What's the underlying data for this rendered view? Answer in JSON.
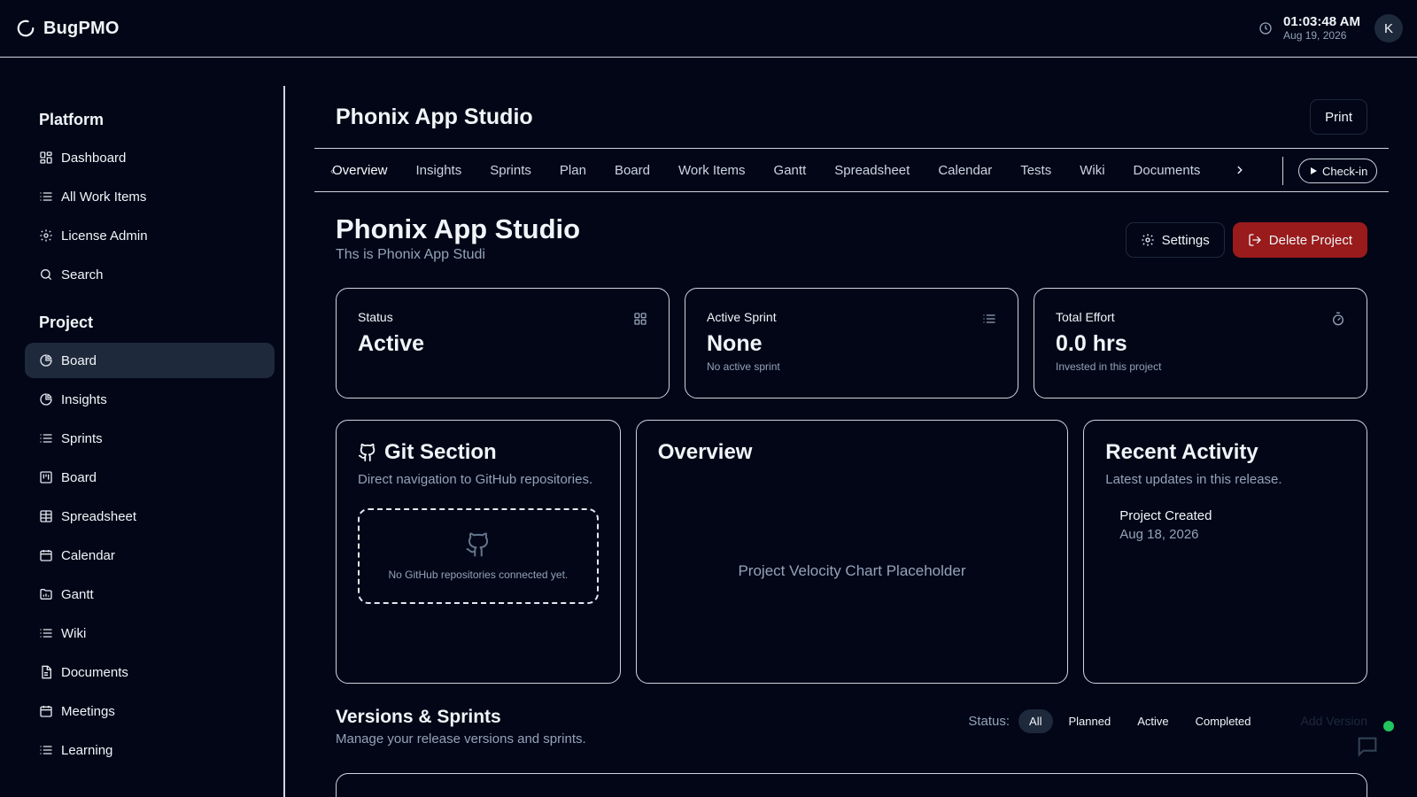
{
  "header": {
    "brand": "BugPMO",
    "time": "01:03:48 AM",
    "date": "Aug 19, 2026",
    "avatar_initial": "K"
  },
  "sidebar": {
    "platform_title": "Platform",
    "platform_items": [
      {
        "label": "Dashboard",
        "icon": "dashboard-grid-icon"
      },
      {
        "label": "All Work Items",
        "icon": "list-icon"
      },
      {
        "label": "License Admin",
        "icon": "gear-icon"
      },
      {
        "label": "Search",
        "icon": "search-icon"
      }
    ],
    "project_title": "Project",
    "project_items": [
      {
        "label": "Board",
        "icon": "pie-chart-icon",
        "active": true
      },
      {
        "label": "Insights",
        "icon": "pie-chart-icon"
      },
      {
        "label": "Sprints",
        "icon": "list-icon"
      },
      {
        "label": "Board",
        "icon": "kanban-icon"
      },
      {
        "label": "Spreadsheet",
        "icon": "table-icon"
      },
      {
        "label": "Calendar",
        "icon": "calendar-icon"
      },
      {
        "label": "Gantt",
        "icon": "folder-chart-icon"
      },
      {
        "label": "Wiki",
        "icon": "list-icon"
      },
      {
        "label": "Documents",
        "icon": "document-icon"
      },
      {
        "label": "Meetings",
        "icon": "calendar-icon"
      },
      {
        "label": "Learning",
        "icon": "list-icon"
      }
    ]
  },
  "page": {
    "title": "Phonix App Studio",
    "print_label": "Print"
  },
  "tabs": {
    "items": [
      "Overview",
      "Insights",
      "Sprints",
      "Plan",
      "Board",
      "Work Items",
      "Gantt",
      "Spreadsheet",
      "Calendar",
      "Tests",
      "Wiki",
      "Documents"
    ],
    "active": "Overview",
    "checkin_label": "Check-in"
  },
  "project": {
    "title": "Phonix App Studio",
    "description": "Ths is Phonix App Studi",
    "settings_label": "Settings",
    "delete_label": "Delete Project"
  },
  "stats": {
    "status": {
      "label": "Status",
      "value": "Active",
      "sub": ""
    },
    "sprint": {
      "label": "Active Sprint",
      "value": "None",
      "sub": "No active sprint"
    },
    "effort": {
      "label": "Total Effort",
      "value": "0.0 hrs",
      "sub": "Invested in this project"
    }
  },
  "git": {
    "title": "Git Section",
    "subtitle": "Direct navigation to GitHub repositories.",
    "empty": "No GitHub repositories connected yet."
  },
  "overview": {
    "title": "Overview",
    "placeholder": "Project Velocity Chart Placeholder"
  },
  "activity": {
    "title": "Recent Activity",
    "subtitle": "Latest updates in this release.",
    "items": [
      {
        "title": "Project Created",
        "date": "Aug 18, 2026"
      }
    ]
  },
  "versions": {
    "title": "Versions & Sprints",
    "subtitle": "Manage your release versions and sprints.",
    "filter_label": "Status:",
    "filters": [
      "All",
      "Planned",
      "Active",
      "Completed"
    ],
    "active_filter": "All",
    "add_label": "Add Version"
  },
  "colors": {
    "background": "#020617",
    "border": "#cbd5e1",
    "danger": "#991b1b",
    "online": "#22c55e"
  }
}
